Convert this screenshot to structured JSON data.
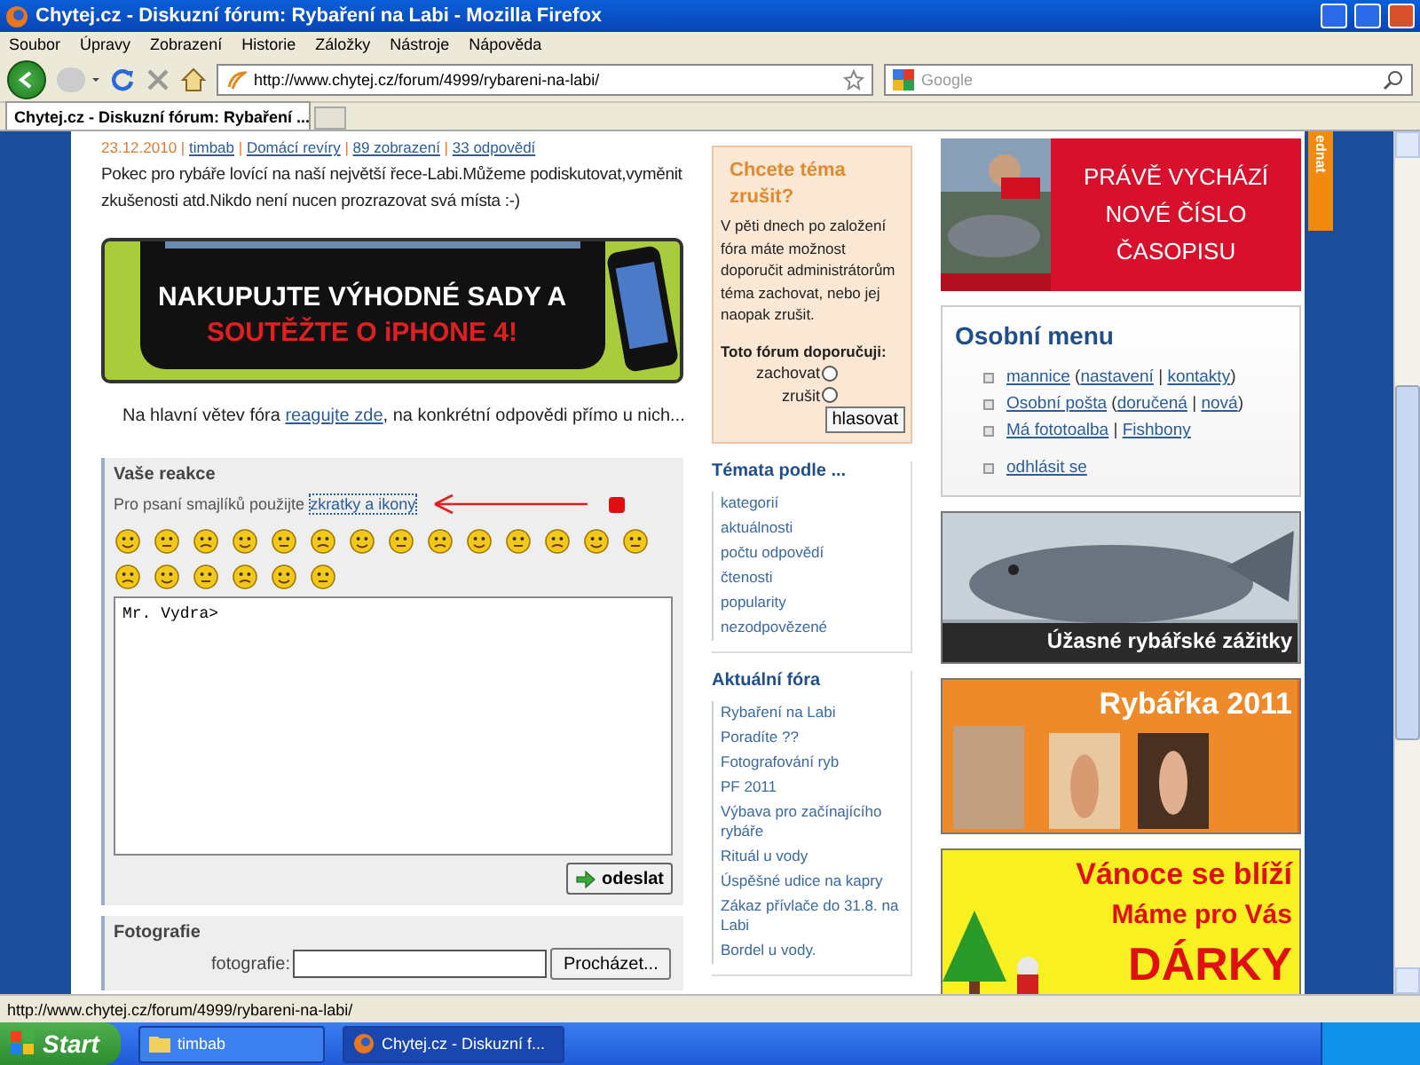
{
  "window": {
    "title": "Chytej.cz - Diskuzní fórum: Rybaření na Labi - Mozilla Firefox"
  },
  "menu": [
    "Soubor",
    "Úpravy",
    "Zobrazení",
    "Historie",
    "Záložky",
    "Nástroje",
    "Nápověda"
  ],
  "toolbar": {
    "url": "http://www.chytej.cz/forum/4999/rybareni-na-labi/",
    "search_placeholder": "Google"
  },
  "tabs": [
    {
      "label": "Chytej.cz - Diskuzní fórum: Rybaření ...",
      "selected": true
    }
  ],
  "post": {
    "meta": [
      {
        "text": "23.12.2010",
        "kind": "plain"
      },
      {
        "text": " | ",
        "kind": "plain"
      },
      {
        "text": "timbab",
        "kind": "link"
      },
      {
        "text": " | ",
        "kind": "plain"
      },
      {
        "text": "Domácí revíry",
        "kind": "link"
      },
      {
        "text": " | ",
        "kind": "plain"
      },
      {
        "text": "89 zobrazení",
        "kind": "link"
      },
      {
        "text": " | ",
        "kind": "plain"
      },
      {
        "text": "33 odpovědí",
        "kind": "link"
      }
    ],
    "body": "Pokec pro rybáře lovící na naší největší řece-Labi.Můžeme podiskutovat,vyměnit zkušenosti atd.Nikdo není nucen prozrazovat svá místa :-)",
    "banner": [
      "NAKUPUJTE VÝHODNÉ SADY A",
      "SOUTĚŽTE O iPHONE 4!"
    ],
    "reply_before": "Na hlavní větev fóra ",
    "reply_link": "reagujte zde",
    "reply_after": ", na konkrétní odpovědi přímo u nich..."
  },
  "reaction": {
    "title": "Vaše reakce",
    "hint": "Pro psaní smajlíků použijte",
    "hint_link": "zkratky a ikony",
    "text": "Mr. Vydra>",
    "submit": "odeslat"
  },
  "photos": {
    "title": "Fotografie",
    "label": "fotografie:",
    "browse": "Procházet..."
  },
  "cancel_box": {
    "title": "Chcete téma zrušit?",
    "text": "V pěti dnech po založení fóra máte možnost doporučit administrátorům téma zachovat, nebo jej naopak zrušit.",
    "question": "Toto fórum doporučuji:",
    "options": [
      {
        "label": "zachovat",
        "selected": false
      },
      {
        "label": "zrušit",
        "selected": false
      }
    ],
    "button": "hlasovat"
  },
  "topics": {
    "title": "Témata podle ...",
    "links": [
      "kategorií",
      "aktuálnosti",
      "počtu odpovědí",
      "čtenosti",
      "popularity",
      "nezodpovězené"
    ]
  },
  "current_forums": {
    "title": "Aktuální fóra",
    "links": [
      "Rybaření na Labi",
      "Poradíte ??",
      "Fotografování ryb",
      "PF 2011",
      "Výbava pro začínajícího rybáře",
      "Rituál u vody",
      "Úspěšné udice na kapry",
      "Zákaz přívlače do 31.8. na Labi",
      "Bordel u vody."
    ]
  },
  "magazine_ad": [
    "PRÁVĚ VYCHÁZÍ",
    "NOVÉ ČÍSLO",
    "ČASOPISU"
  ],
  "personal_menu": {
    "title": "Osobní menu",
    "items": [
      [
        {
          "text": "mannice",
          "kind": "link"
        },
        {
          "text": " (",
          "kind": "plain"
        },
        {
          "text": "nastavení",
          "kind": "link"
        },
        {
          "text": " | ",
          "kind": "plain"
        },
        {
          "text": "kontakty",
          "kind": "link"
        },
        {
          "text": ")",
          "kind": "plain"
        }
      ],
      [
        {
          "text": "Osobní pošta",
          "kind": "link"
        },
        {
          "text": " (",
          "kind": "plain"
        },
        {
          "text": "doručená",
          "kind": "link"
        },
        {
          "text": " | ",
          "kind": "plain"
        },
        {
          "text": "nová",
          "kind": "link"
        },
        {
          "text": ")",
          "kind": "plain"
        }
      ],
      [
        {
          "text": "Má fototoalba",
          "kind": "link"
        },
        {
          "text": " | ",
          "kind": "plain"
        },
        {
          "text": "Fishbony",
          "kind": "link"
        }
      ],
      [
        {
          "text": "odhlásit se",
          "kind": "link"
        }
      ]
    ]
  },
  "side_ads": [
    {
      "kind": "fish",
      "lines": [
        "Úžasné rybářské zážitky"
      ]
    },
    {
      "kind": "calendar",
      "lines": [
        "Rybářka 2011"
      ]
    },
    {
      "kind": "christmas",
      "lines": [
        "Vánoce se blíží",
        "Máme pro Vás",
        "DÁRKY"
      ]
    }
  ],
  "side_tab": "ednat",
  "status_bar": "http://www.chytej.cz/forum/4999/rybareni-na-labi/",
  "taskbar": {
    "start": "Start",
    "items": [
      {
        "label": "timbab",
        "kind": "folder",
        "selected": false
      },
      {
        "label": "Chytej.cz - Diskuzní f...",
        "kind": "browser",
        "selected": true
      }
    ]
  }
}
